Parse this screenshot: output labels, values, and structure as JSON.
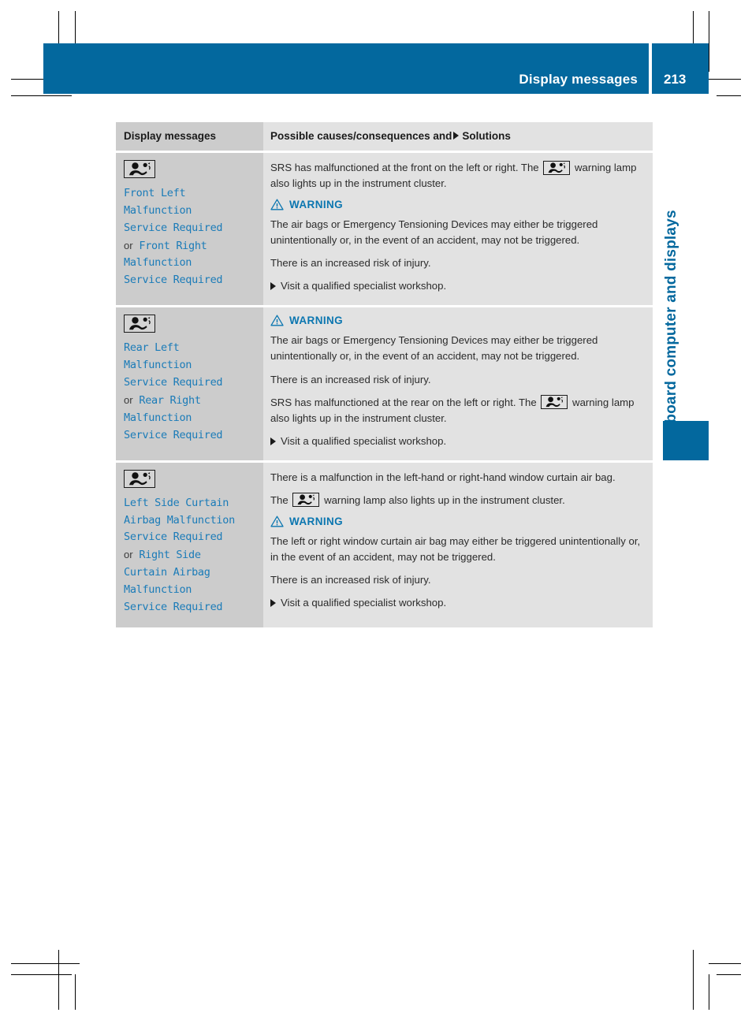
{
  "header": {
    "title": "Display messages",
    "page_number": "213"
  },
  "side_tab": {
    "label": "On-board computer and displays"
  },
  "table": {
    "columns": {
      "left_header": "Display messages",
      "right_header_before": "Possible causes/consequences and",
      "right_header_after": "Solutions"
    },
    "rows": [
      {
        "icon": "airbag-occupant-icon",
        "messages": [
          {
            "type": "message",
            "text": "Front Left"
          },
          {
            "type": "message",
            "text": "Malfunction"
          },
          {
            "type": "message",
            "text": "Service Required"
          },
          {
            "type": "or",
            "text": "or"
          },
          {
            "type": "message",
            "text": "Front Right"
          },
          {
            "type": "message",
            "text": "Malfunction"
          },
          {
            "type": "message",
            "text": "Service Required"
          }
        ],
        "content": [
          {
            "kind": "paragraph-with-icon",
            "before": "SRS has malfunctioned at the front on the left or right. The",
            "icon": "airbag-occupant-icon",
            "after": "warning lamp also lights up in the instrument cluster."
          },
          {
            "kind": "warning-heading",
            "label": "WARNING"
          },
          {
            "kind": "paragraph",
            "text": "The air bags or Emergency Tensioning Devices may either be triggered unintentionally or, in the event of an accident, may not be triggered."
          },
          {
            "kind": "paragraph",
            "text": "There is an increased risk of injury."
          },
          {
            "kind": "bullet",
            "text": "Visit a qualified specialist workshop."
          }
        ]
      },
      {
        "icon": "airbag-occupant-icon",
        "messages": [
          {
            "type": "message",
            "text": "Rear Left"
          },
          {
            "type": "message",
            "text": "Malfunction"
          },
          {
            "type": "message",
            "text": "Service Required"
          },
          {
            "type": "or",
            "text": "or"
          },
          {
            "type": "message",
            "text": "Rear Right"
          },
          {
            "type": "message",
            "text": "Malfunction"
          },
          {
            "type": "message",
            "text": "Service Required"
          }
        ],
        "content": [
          {
            "kind": "warning-heading",
            "label": "WARNING"
          },
          {
            "kind": "paragraph",
            "text": "The air bags or Emergency Tensioning Devices may either be triggered unintentionally or, in the event of an accident, may not be triggered."
          },
          {
            "kind": "paragraph",
            "text": "There is an increased risk of injury."
          },
          {
            "kind": "paragraph-with-icon",
            "before": "SRS has malfunctioned at the rear on the left or right. The",
            "icon": "airbag-occupant-icon",
            "after": "warning lamp also lights up in the instrument cluster."
          },
          {
            "kind": "bullet",
            "text": "Visit a qualified specialist workshop."
          }
        ]
      },
      {
        "icon": "airbag-occupant-icon",
        "messages": [
          {
            "type": "message",
            "text": "Left Side Curtain"
          },
          {
            "type": "message",
            "text": "Airbag Malfunction"
          },
          {
            "type": "message",
            "text": "Service Required"
          },
          {
            "type": "or",
            "text": "or"
          },
          {
            "type": "message",
            "text": "Right Side"
          },
          {
            "type": "message",
            "text": "Curtain Airbag"
          },
          {
            "type": "message",
            "text": "Malfunction"
          },
          {
            "type": "message",
            "text": "Service Required"
          }
        ],
        "content": [
          {
            "kind": "paragraph",
            "text": "There is a malfunction in the left-hand or right-hand window curtain air bag."
          },
          {
            "kind": "paragraph-with-icon",
            "before": "The",
            "icon": "airbag-occupant-icon",
            "after": "warning lamp also lights up in the instrument cluster."
          },
          {
            "kind": "warning-heading",
            "label": "WARNING"
          },
          {
            "kind": "paragraph",
            "text": "The left or right window curtain air bag may either be triggered unintentionally or, in the event of an accident, may not be triggered."
          },
          {
            "kind": "paragraph",
            "text": "There is an increased risk of injury."
          },
          {
            "kind": "bullet",
            "text": "Visit a qualified specialist workshop."
          }
        ]
      }
    ]
  },
  "colors": {
    "brand_blue": "#03689e",
    "message_blue": "#1a7bb8",
    "warning_blue": "#0b76b0",
    "col_left_bg": "#cccccc",
    "col_right_bg": "#e2e2e2"
  }
}
